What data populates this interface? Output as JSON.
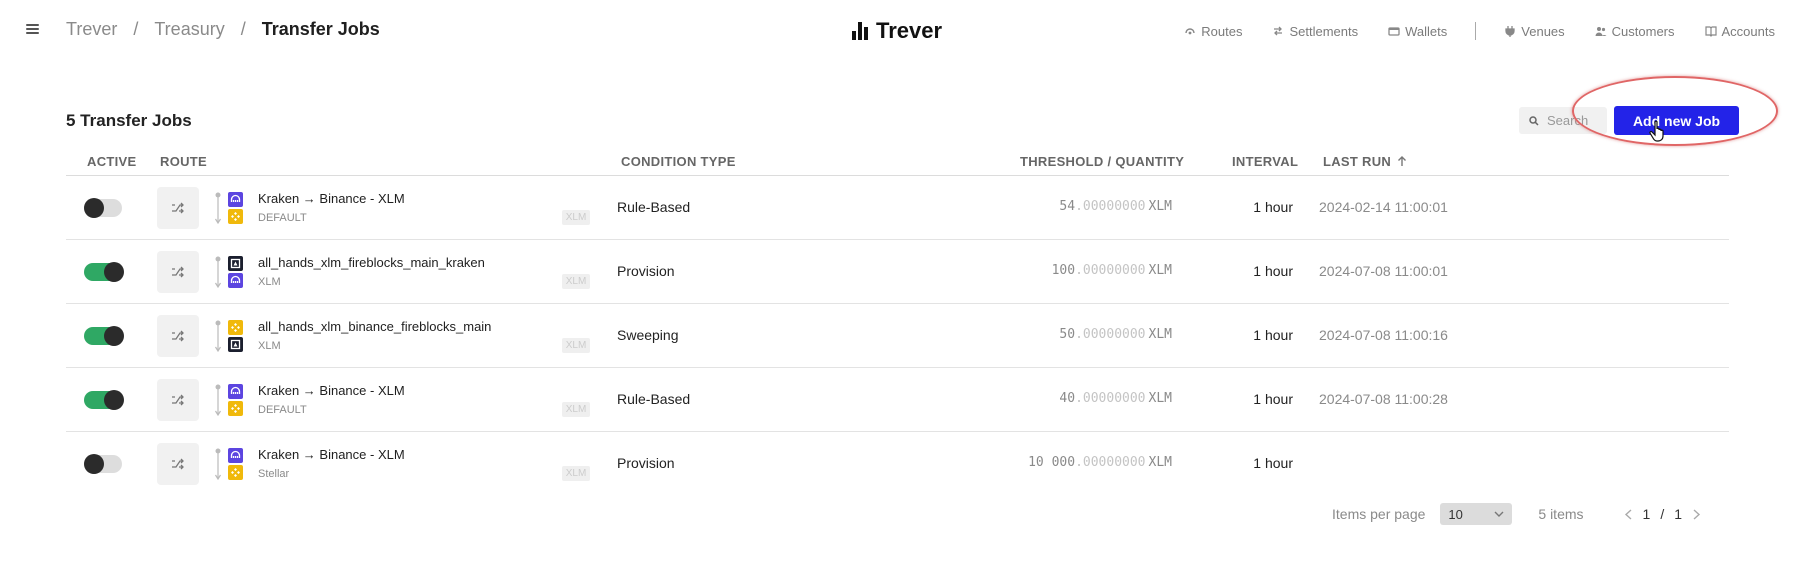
{
  "breadcrumb": [
    "Trever",
    "Treasury",
    "Transfer Jobs"
  ],
  "logo": {
    "text": "Trever"
  },
  "nav": [
    {
      "label": "Routes",
      "icon": "routes-icon"
    },
    {
      "label": "Settlements",
      "icon": "settlements-icon"
    },
    {
      "label": "Wallets",
      "icon": "wallet-icon"
    },
    {
      "label": "Venues",
      "icon": "venues-icon"
    },
    {
      "label": "Customers",
      "icon": "customers-icon"
    },
    {
      "label": "Accounts",
      "icon": "accounts-icon"
    }
  ],
  "page": {
    "title": "5 Transfer Jobs",
    "search_placeholder": "Search",
    "add_button": "Add new Job"
  },
  "columns": {
    "active": "ACTIVE",
    "route": "ROUTE",
    "condition": "CONDITION TYPE",
    "threshold": "THRESHOLD / QUANTITY",
    "interval": "INTERVAL",
    "last_run": "LAST RUN"
  },
  "rows": [
    {
      "active": false,
      "from": "kraken",
      "to": "binance",
      "name": "Kraken → Binance - XLM",
      "sub": "DEFAULT",
      "asset": "XLM",
      "condition": "Rule-Based",
      "qty_int": "54",
      "qty_dec": ".00000000",
      "unit": "XLM",
      "interval": "1 hour",
      "last_run": "2024-02-14 11:00:01"
    },
    {
      "active": true,
      "from": "fireblocks",
      "to": "kraken",
      "name": "all_hands_xlm_fireblocks_main_kraken",
      "sub": "XLM",
      "asset": "XLM",
      "condition": "Provision",
      "qty_int": "100",
      "qty_dec": ".00000000",
      "unit": "XLM",
      "interval": "1 hour",
      "last_run": "2024-07-08 11:00:01"
    },
    {
      "active": true,
      "from": "binance",
      "to": "fireblocks",
      "name": "all_hands_xlm_binance_fireblocks_main",
      "sub": "XLM",
      "asset": "XLM",
      "condition": "Sweeping",
      "qty_int": "50",
      "qty_dec": ".00000000",
      "unit": "XLM",
      "interval": "1 hour",
      "last_run": "2024-07-08 11:00:16"
    },
    {
      "active": true,
      "from": "kraken",
      "to": "binance",
      "name": "Kraken → Binance - XLM",
      "sub": "DEFAULT",
      "asset": "XLM",
      "condition": "Rule-Based",
      "qty_int": "40",
      "qty_dec": ".00000000",
      "unit": "XLM",
      "interval": "1 hour",
      "last_run": "2024-07-08 11:00:28"
    },
    {
      "active": false,
      "from": "kraken",
      "to": "binance",
      "name": "Kraken → Binance - XLM",
      "sub": "Stellar",
      "asset": "XLM",
      "condition": "Provision",
      "qty_int": "10 000",
      "qty_dec": ".00000000",
      "unit": "XLM",
      "interval": "1 hour",
      "last_run": ""
    }
  ],
  "pagination": {
    "items_per_page_label": "Items per page",
    "items_per_page_value": "10",
    "items_count": "5 items",
    "current_page": "1",
    "separator": "/",
    "total_pages": "1"
  },
  "colors": {
    "accent": "#2323e8",
    "toggle_on": "#2fa864",
    "kraken": "#5c45e0",
    "binance": "#f0b90b",
    "fireblocks": "#1b1f2e"
  }
}
